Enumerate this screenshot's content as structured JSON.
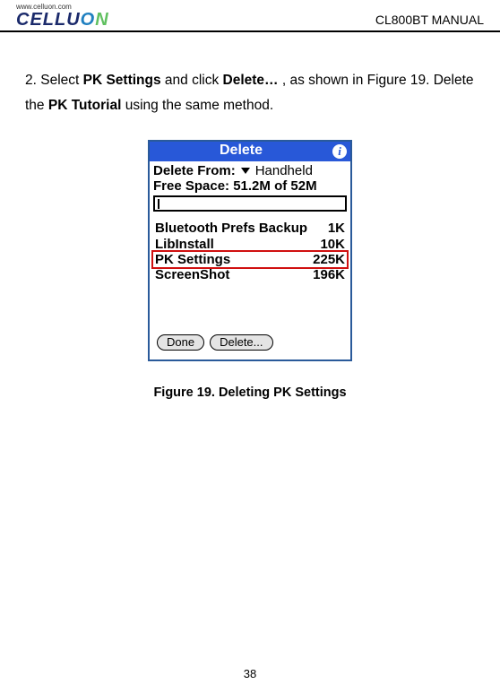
{
  "header": {
    "logo_url": "www.celluon.com",
    "brand_part1": "CELLU",
    "brand_o1": "O",
    "brand_o2": "N",
    "manual_title": "CL800BT MANUAL"
  },
  "body": {
    "step_prefix": "2. Select ",
    "step_bold1": "PK Settings",
    "step_mid": " and click ",
    "step_bold2": "Delete…",
    "step_suffix": " , as shown in Figure 19. Delete the ",
    "step_bold3": "PK Tutorial",
    "step_end": " using the same method."
  },
  "palm": {
    "title": "Delete",
    "delete_from_label": "Delete From:",
    "delete_from_value": "Handheld",
    "free_space": "Free Space: 51.2M of 52M",
    "files": [
      {
        "name": "Bluetooth Prefs Backup",
        "size": "1K",
        "highlight": false
      },
      {
        "name": "LibInstall",
        "size": "10K",
        "highlight": false
      },
      {
        "name": "PK Settings",
        "size": "225K",
        "highlight": true
      },
      {
        "name": "ScreenShot",
        "size": "196K",
        "highlight": false
      }
    ],
    "btn_done": "Done",
    "btn_delete": "Delete..."
  },
  "caption": "Figure 19. Deleting PK Settings",
  "page_number": "38"
}
